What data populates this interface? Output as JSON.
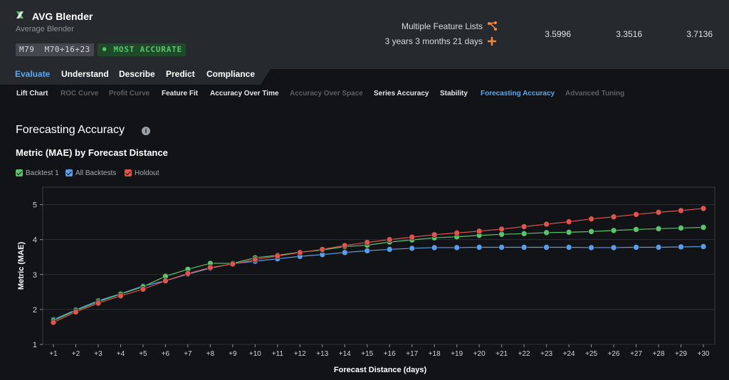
{
  "header": {
    "title": "AVG Blender",
    "subtitle": "Average Blender",
    "model_id": "M79  M70+16+23",
    "accuracy_badge": "MOST ACCURATE",
    "feature_list": "Multiple Feature Lists",
    "duration": "3 years 3 months 21 days",
    "scores": [
      "3.5996",
      "3.3516",
      "3.7136"
    ]
  },
  "main_tabs": [
    "Evaluate",
    "Understand",
    "Describe",
    "Predict",
    "Compliance"
  ],
  "active_main_tab": "Evaluate",
  "sub_tabs": [
    {
      "label": "Lift Chart",
      "state": "normal"
    },
    {
      "label": "ROC Curve",
      "state": "dim"
    },
    {
      "label": "Profit Curve",
      "state": "dim"
    },
    {
      "label": "Feature Fit",
      "state": "normal"
    },
    {
      "label": "Accuracy Over Time",
      "state": "normal"
    },
    {
      "label": "Accuracy Over Space",
      "state": "dim"
    },
    {
      "label": "Series Accuracy",
      "state": "normal"
    },
    {
      "label": "Stability",
      "state": "normal"
    },
    {
      "label": "Forecasting Accuracy",
      "state": "active"
    },
    {
      "label": "Advanced Tuning",
      "state": "dim"
    }
  ],
  "page": {
    "title": "Forecasting Accuracy",
    "info_icon": "i",
    "subtitle": "Metric (MAE) by Forecast Distance"
  },
  "colors": {
    "backtest": "#5cc36d",
    "all": "#5b9ee8",
    "holdout": "#e0544e"
  },
  "chart_data": {
    "type": "line",
    "xlabel": "Forecast Distance (days)",
    "ylabel": "Metric (MAE)",
    "ylim": [
      1,
      5.5
    ],
    "yticks": [
      1,
      2,
      3,
      4,
      5
    ],
    "x": [
      "+1",
      "+2",
      "+3",
      "+4",
      "+5",
      "+6",
      "+7",
      "+8",
      "+9",
      "+10",
      "+11",
      "+12",
      "+13",
      "+14",
      "+15",
      "+16",
      "+17",
      "+18",
      "+19",
      "+20",
      "+21",
      "+22",
      "+23",
      "+24",
      "+25",
      "+26",
      "+27",
      "+28",
      "+29",
      "+30"
    ],
    "grid": true,
    "legend": "top-left",
    "series": [
      {
        "name": "Backtest 1",
        "color": "#5cc36d",
        "values": [
          1.68,
          1.97,
          2.22,
          2.44,
          2.65,
          2.95,
          3.15,
          3.32,
          3.32,
          3.48,
          3.55,
          3.64,
          3.7,
          3.8,
          3.84,
          3.93,
          3.99,
          4.05,
          4.08,
          4.12,
          4.15,
          4.17,
          4.2,
          4.21,
          4.23,
          4.26,
          4.29,
          4.31,
          4.33,
          4.35
        ]
      },
      {
        "name": "All Backtests",
        "color": "#5b9ee8",
        "values": [
          1.71,
          1.99,
          2.25,
          2.45,
          2.67,
          2.82,
          3.01,
          3.18,
          3.31,
          3.38,
          3.45,
          3.52,
          3.57,
          3.63,
          3.68,
          3.72,
          3.75,
          3.77,
          3.77,
          3.78,
          3.78,
          3.78,
          3.78,
          3.78,
          3.77,
          3.77,
          3.78,
          3.78,
          3.79,
          3.8
        ]
      },
      {
        "name": "Holdout",
        "color": "#e0544e",
        "values": [
          1.63,
          1.93,
          2.18,
          2.39,
          2.58,
          2.82,
          3.03,
          3.2,
          3.3,
          3.43,
          3.53,
          3.63,
          3.72,
          3.83,
          3.92,
          4.0,
          4.07,
          4.14,
          4.19,
          4.24,
          4.3,
          4.37,
          4.44,
          4.51,
          4.59,
          4.65,
          4.72,
          4.78,
          4.83,
          4.89
        ]
      }
    ]
  }
}
